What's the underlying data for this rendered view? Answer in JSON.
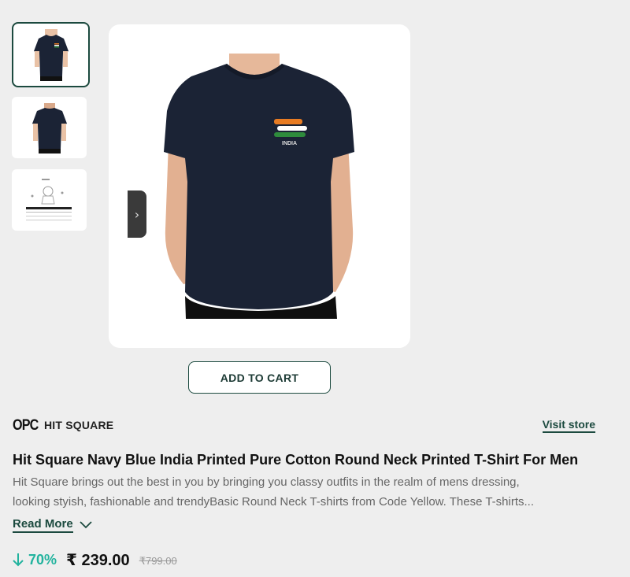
{
  "gallery": {
    "thumbnails": [
      {
        "alt": "front view"
      },
      {
        "alt": "back view"
      },
      {
        "alt": "size chart"
      }
    ],
    "next_icon": "chevron-right-icon"
  },
  "product_image": {
    "print_text": "INDIA",
    "shirt_color": "#1b2335"
  },
  "actions": {
    "add_to_cart": "ADD TO CART"
  },
  "store": {
    "logo_text": "OPC",
    "name": "HIT SQUARE",
    "visit_label": "Visit store"
  },
  "product": {
    "title": "Hit Square Navy Blue India Printed Pure Cotton Round Neck Printed T-Shirt For Men",
    "description_line1": "Hit Square brings out the best in you by bringing you classy outfits in the realm of mens dressing,",
    "description_line2": "looking styish, fashionable and trendyBasic Round Neck T-shirts from Code Yellow. These T-shirts...",
    "read_more": "Read More"
  },
  "pricing": {
    "discount": "70%",
    "price": "₹ 239.00",
    "mrp": "₹799.00"
  },
  "colors": {
    "accent": "#1c4a3f",
    "discount_green": "#22b39e",
    "background": "#eeeeee"
  }
}
